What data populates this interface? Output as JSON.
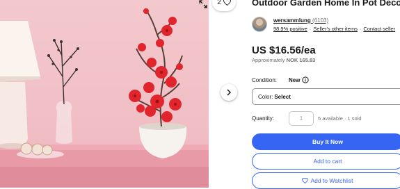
{
  "gallery": {
    "watch_count": "2",
    "icons": {
      "expand": "expand-icon",
      "watch": "heart-icon",
      "next": "chevron-right-icon"
    }
  },
  "listing": {
    "title": "Outdoor Garden Home In Pot Decor"
  },
  "seller": {
    "name": "wersammlung",
    "feedback_count": "(6103)",
    "positive": "98.9% positive",
    "other_items": "Seller's other items",
    "contact": "Contact seller",
    "separator": "·"
  },
  "price": {
    "main": "US $16.56/ea",
    "approx_label": "Approximately",
    "approx_value": "NOK 165.83"
  },
  "condition": {
    "label": "Condition:",
    "value": "New"
  },
  "variation": {
    "label": "Color:",
    "value": "Select"
  },
  "quantity": {
    "label": "Quantity:",
    "value": "1",
    "status": "5 available · 1 sold"
  },
  "actions": {
    "buy_now": "Buy It Now",
    "add_to_cart": "Add to cart",
    "add_to_watchlist": "Add to Watchlist"
  },
  "colors": {
    "accent": "#3665f3",
    "text": "#191919",
    "muted": "#707070"
  }
}
